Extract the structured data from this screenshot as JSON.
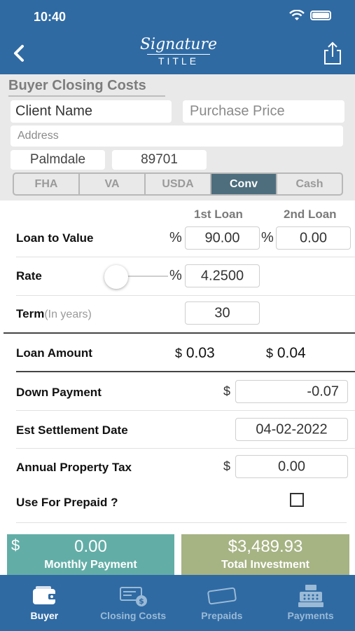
{
  "status_bar": {
    "time": "10:40"
  },
  "nav": {
    "logo_script": "Signature",
    "logo_word": "TITLE"
  },
  "form": {
    "section_title": "Buyer Closing Costs",
    "client_name": "Client Name",
    "purchase_price_placeholder": "Purchase Price",
    "address_placeholder": "Address",
    "city": "Palmdale",
    "zip": "89701",
    "loan_types": [
      "FHA",
      "VA",
      "USDA",
      "Conv",
      "Cash"
    ],
    "selected_loan_type": "Conv"
  },
  "calc": {
    "col_1st": "1st Loan",
    "col_2nd": "2nd Loan",
    "ltv_label": "Loan to Value",
    "percent_symbol": "%",
    "dollar_symbol": "$",
    "ltv_1st": "90.00",
    "ltv_2nd": "0.00",
    "rate_label": "Rate",
    "rate_value": "4.2500",
    "term_label": "Term",
    "term_sub": "(In years)",
    "term_value": "30",
    "loan_amount_label": "Loan Amount",
    "loan_amount_1st": "0.03",
    "loan_amount_2nd": "0.04",
    "down_payment_label": "Down Payment",
    "down_payment_value": "-0.07",
    "settlement_label": "Est Settlement Date",
    "settlement_value": "04-02-2022",
    "property_tax_label": "Annual Property Tax",
    "property_tax_value": "0.00",
    "use_prepaid_label": "Use For Prepaid ?"
  },
  "summary": {
    "monthly_dollar": "$",
    "monthly_value": "0.00",
    "monthly_label": "Monthly Payment",
    "total_value": "$3,489.93",
    "total_label": "Total Investment"
  },
  "tabs": [
    {
      "label": "Buyer",
      "icon": "wallet-icon"
    },
    {
      "label": "Closing Costs",
      "icon": "check-dollar-icon"
    },
    {
      "label": "Prepaids",
      "icon": "paid-stamp-icon"
    },
    {
      "label": "Payments",
      "icon": "cash-register-icon"
    }
  ],
  "colors": {
    "brand_blue": "#2f6aa3",
    "selected_segment": "#4e6e7e",
    "monthly_tile": "#63ada7",
    "total_tile": "#a6b383"
  }
}
